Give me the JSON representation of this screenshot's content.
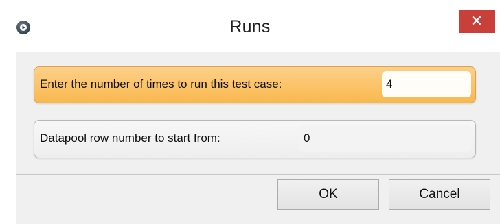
{
  "window": {
    "title": "Runs",
    "close_glyph": "✕",
    "app_icon": "play-icon"
  },
  "fields": {
    "runs": {
      "label": "Enter the number of times to run this test case:",
      "value": "4"
    },
    "start_row": {
      "label": "Datapool row number to start from:",
      "value": "0"
    }
  },
  "buttons": {
    "ok": "OK",
    "cancel": "Cancel"
  },
  "colors": {
    "highlight": "#fcc46a",
    "close": "#c9403a"
  }
}
